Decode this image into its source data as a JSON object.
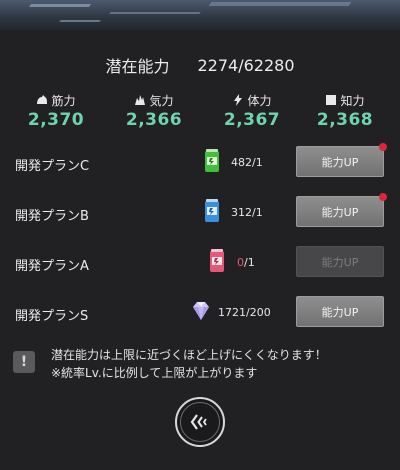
{
  "potential": {
    "label": "潜在能力",
    "value": "2274/62280"
  },
  "stats": [
    {
      "label": "筋力",
      "value": "2,370",
      "icon": "muscle-icon"
    },
    {
      "label": "気力",
      "value": "2,366",
      "icon": "flame-icon"
    },
    {
      "label": "体力",
      "value": "2,367",
      "icon": "bolt-icon"
    },
    {
      "label": "知力",
      "value": "2,368",
      "icon": "square-icon"
    }
  ],
  "plans": [
    {
      "name": "開発プランC",
      "count": "482/1",
      "button": "能力UP",
      "enabled": true,
      "badge": true,
      "item_icon": "green-drink-icon"
    },
    {
      "name": "開発プランB",
      "count": "312/1",
      "button": "能力UP",
      "enabled": true,
      "badge": true,
      "item_icon": "blue-drink-icon"
    },
    {
      "name": "開発プランA",
      "count_owned": "0",
      "count_need": "/1",
      "button": "能力UP",
      "enabled": false,
      "badge": false,
      "item_icon": "pink-drink-icon"
    },
    {
      "name": "開発プランS",
      "count": "1721/200",
      "button": "能力UP",
      "enabled": true,
      "badge": false,
      "item_icon": "diamond-icon"
    }
  ],
  "note": {
    "line1": "潜在能力は上限に近づくほど上げにくくなります！",
    "line2": "※統率Lv.に比例して上限が上がります"
  },
  "colors": {
    "stat_value": "#6fd3ad",
    "badge": "#e0243a",
    "zero_count": "#e05b6a"
  }
}
